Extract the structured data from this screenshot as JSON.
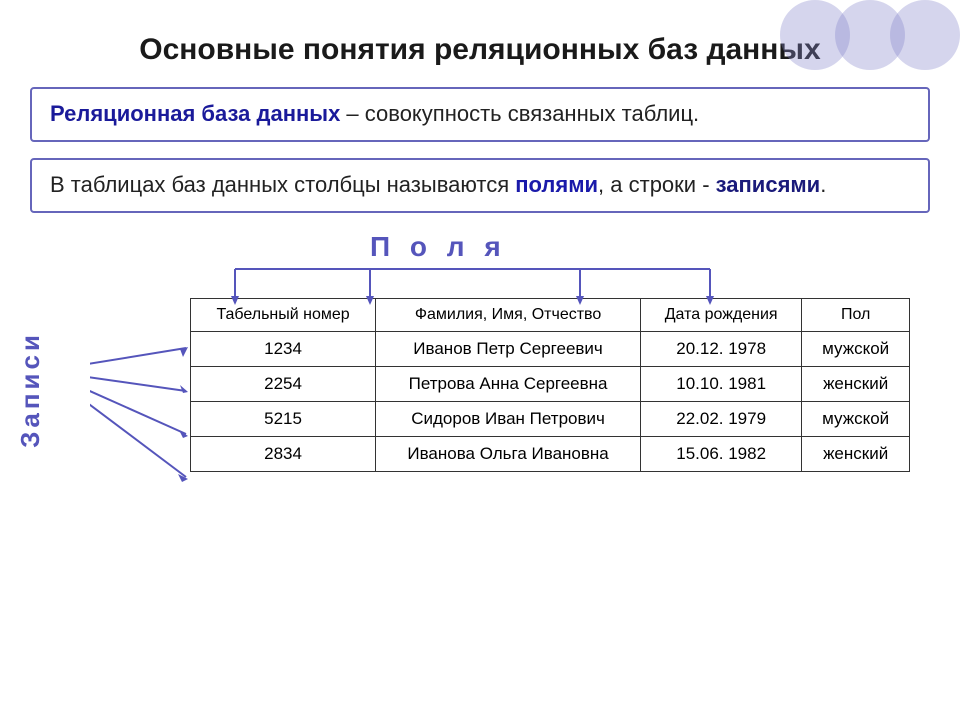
{
  "title": "Основные понятия реляционных баз данных",
  "definition": {
    "term": "Реляционная база данных",
    "rest": " – совокупность связанных таблиц."
  },
  "info_text": {
    "before": "В таблицах баз данных столбцы называются ",
    "fields_word": "полями",
    "middle": ", а строки - ",
    "records_word": "записями",
    "end": "."
  },
  "fields_label": "П о л я",
  "records_label": "Записи",
  "table": {
    "headers": [
      "Табельный номер",
      "Фамилия, Имя, Отчество",
      "Дата рождения",
      "Пол"
    ],
    "rows": [
      [
        "1234",
        "Иванов Петр Сергеевич",
        "20.12. 1978",
        "мужской"
      ],
      [
        "2254",
        "Петрова Анна Сергеевна",
        "10.10. 1981",
        "женский"
      ],
      [
        "5215",
        "Сидоров Иван Петрович",
        "22.02. 1979",
        "мужской"
      ],
      [
        "2834",
        "Иванова Ольга Ивановна",
        "15.06. 1982",
        "женский"
      ]
    ]
  }
}
